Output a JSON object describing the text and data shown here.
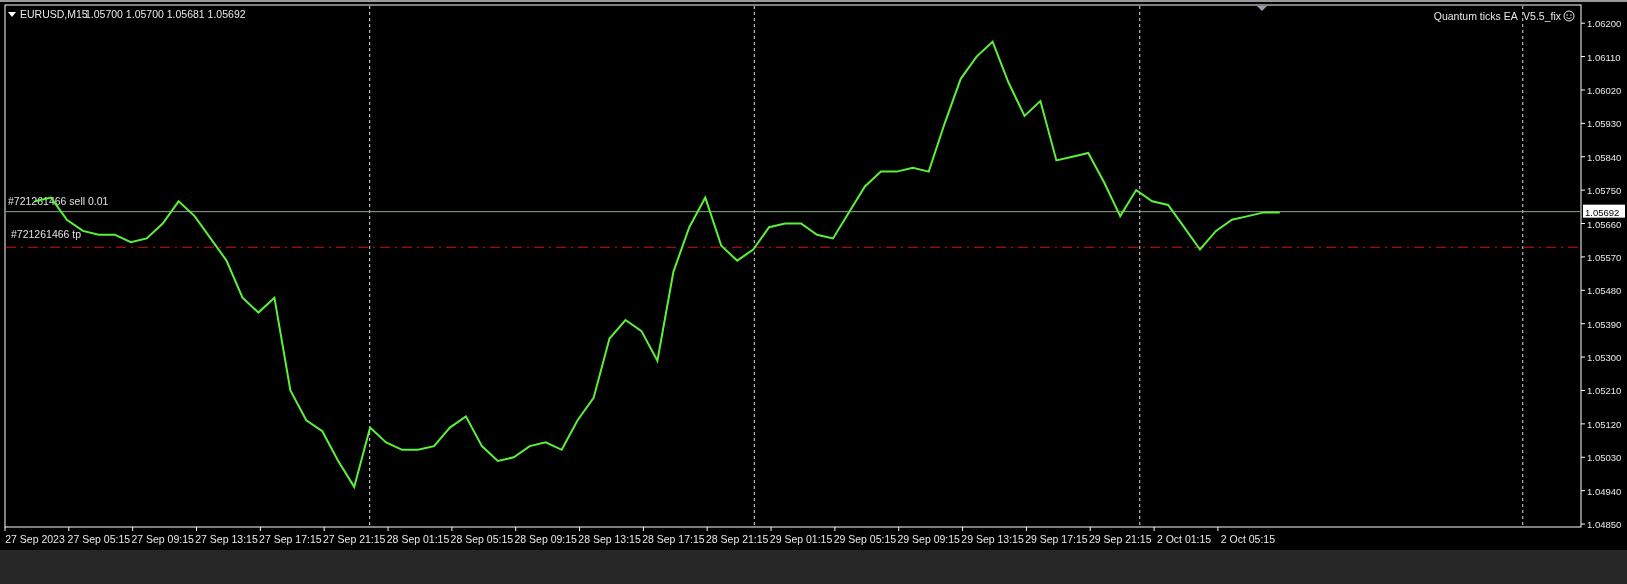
{
  "header": {
    "symbol": "EURUSD,M15",
    "ohlc": "1.05700 1.05700 1.05681 1.05692"
  },
  "expert": {
    "label": "Quantum ticks EA  V5.5_fix"
  },
  "chart_data": {
    "type": "line",
    "categories": [
      "27 Sep 2023",
      null,
      null,
      null,
      "27 Sep 05:15",
      null,
      null,
      null,
      "27 Sep 09:15",
      null,
      null,
      null,
      "27 Sep 13:15",
      null,
      null,
      null,
      "27 Sep 17:15",
      null,
      null,
      null,
      "27 Sep 21:15",
      null,
      null,
      null,
      "28 Sep 01:15",
      null,
      null,
      null,
      "28 Sep 05:15",
      null,
      null,
      null,
      "28 Sep 09:15",
      null,
      null,
      null,
      "28 Sep 13:15",
      null,
      null,
      null,
      "28 Sep 17:15",
      null,
      null,
      null,
      "28 Sep 21:15",
      null,
      null,
      null,
      "29 Sep 01:15",
      null,
      null,
      null,
      "29 Sep 05:15",
      null,
      null,
      null,
      "29 Sep 09:15",
      null,
      null,
      null,
      "29 Sep 13:15",
      null,
      null,
      null,
      "29 Sep 17:15",
      null,
      null,
      null,
      "29 Sep 21:15",
      null,
      null,
      null,
      "2 Oct 01:15",
      null,
      null,
      null,
      "2 Oct 05:15",
      null,
      null,
      null,
      null,
      null,
      null,
      null,
      null,
      null,
      null,
      null,
      null,
      null,
      null,
      null,
      null,
      null,
      null,
      null,
      null,
      null,
      null
    ],
    "values": [
      1.0572,
      1.0573,
      1.0567,
      1.0564,
      1.0563,
      1.0563,
      1.0561,
      1.0562,
      1.0566,
      1.0572,
      1.0568,
      1.0562,
      1.0556,
      1.0546,
      1.0542,
      1.0546,
      1.0521,
      1.0513,
      1.051,
      1.0502,
      1.0495,
      1.0511,
      1.0507,
      1.0505,
      1.0505,
      1.0506,
      1.0511,
      1.0514,
      1.0506,
      1.0502,
      1.0503,
      1.0506,
      1.0507,
      1.0505,
      1.0513,
      1.0519,
      1.0535,
      1.054,
      1.0537,
      1.0529,
      1.0553,
      1.0565,
      1.0573,
      1.056,
      1.0556,
      1.0559,
      1.0565,
      1.0566,
      1.0566,
      1.0563,
      1.0562,
      1.0569,
      1.0576,
      1.058,
      1.058,
      1.0581,
      1.058,
      1.0593,
      1.0605,
      1.0611,
      1.0615,
      1.0604,
      1.0595,
      1.0599,
      1.0583,
      1.0584,
      1.0585,
      1.0577,
      1.0568,
      1.0575,
      1.0572,
      1.0571,
      1.0565,
      1.0559,
      1.0564,
      1.0567,
      1.0568,
      1.0569,
      1.0569,
      null,
      null,
      null,
      null,
      null,
      null,
      null,
      null,
      null,
      null,
      null,
      null,
      null,
      null,
      null,
      null,
      null,
      null,
      null,
      null
    ],
    "color": "#5cf03a",
    "ylim": [
      1.04842,
      1.06249
    ],
    "yticks": [
      {
        "value": 1.062,
        "label": "1.06200"
      },
      {
        "value": 1.0611,
        "label": "1.06110"
      },
      {
        "value": 1.0602,
        "label": "1.06020"
      },
      {
        "value": 1.0593,
        "label": "1.05930"
      },
      {
        "value": 1.0584,
        "label": "1.05840"
      },
      {
        "value": 1.0575,
        "label": "1.05750"
      },
      {
        "value": 1.0566,
        "label": "1.05660"
      },
      {
        "value": 1.0557,
        "label": "1.05570"
      },
      {
        "value": 1.0548,
        "label": "1.05480"
      },
      {
        "value": 1.0539,
        "label": "1.05390"
      },
      {
        "value": 1.053,
        "label": "1.05300"
      },
      {
        "value": 1.0521,
        "label": "1.05210"
      },
      {
        "value": 1.0512,
        "label": "1.05120"
      },
      {
        "value": 1.0503,
        "label": "1.05030"
      },
      {
        "value": 1.0494,
        "label": "1.04940"
      },
      {
        "value": 1.0485,
        "label": "1.04850"
      }
    ],
    "ref_lines": [
      {
        "axis": "y",
        "value": 1.05692,
        "label": "#721261466 sell 0.01",
        "color": "#8aa88a"
      },
      {
        "axis": "y",
        "value": 1.05596,
        "label": "#721261466 tp",
        "color": "#d01010"
      }
    ]
  },
  "bid_label": "1.05692"
}
